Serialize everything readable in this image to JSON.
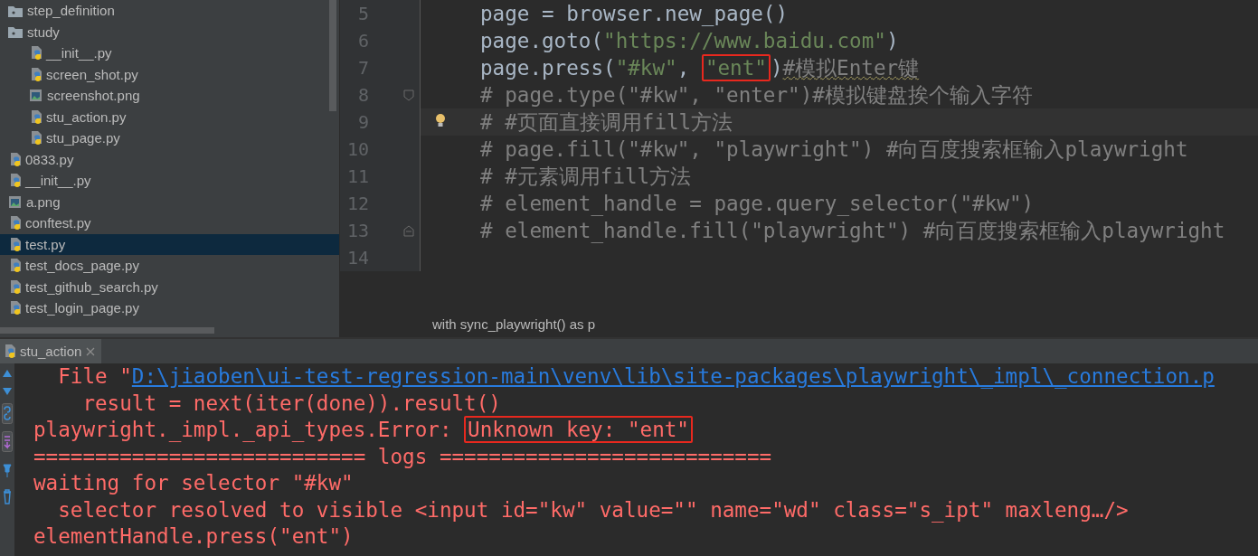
{
  "project_tree": {
    "items": [
      {
        "label": "step_definition",
        "kind": "folder",
        "selected": false
      },
      {
        "label": "study",
        "kind": "folder",
        "selected": false,
        "children": [
          {
            "label": "__init__.py",
            "kind": "python",
            "selected": false
          },
          {
            "label": "screen_shot.py",
            "kind": "python",
            "selected": false
          },
          {
            "label": "screenshot.png",
            "kind": "image",
            "selected": false
          },
          {
            "label": "stu_action.py",
            "kind": "python",
            "selected": false
          },
          {
            "label": "stu_page.py",
            "kind": "python",
            "selected": false
          }
        ]
      },
      {
        "label": "0833.py",
        "kind": "python",
        "selected": false
      },
      {
        "label": "__init__.py",
        "kind": "python",
        "selected": false
      },
      {
        "label": "a.png",
        "kind": "image",
        "selected": false
      },
      {
        "label": "conftest.py",
        "kind": "python",
        "selected": false
      },
      {
        "label": "test.py",
        "kind": "python",
        "selected": true
      },
      {
        "label": "test_docs_page.py",
        "kind": "python",
        "selected": false
      },
      {
        "label": "test_github_search.py",
        "kind": "python",
        "selected": false
      },
      {
        "label": "test_login_page.py",
        "kind": "python",
        "selected": false
      }
    ]
  },
  "editor": {
    "lines": [
      {
        "number": "5",
        "tokens": [
          {
            "text": "page = browser.new_page()",
            "kind": "code"
          }
        ]
      },
      {
        "number": "6",
        "tokens": [
          {
            "text": "page.goto(",
            "kind": "code"
          },
          {
            "text": "\"https://www.baidu.com\"",
            "kind": "string"
          },
          {
            "text": ")",
            "kind": "code"
          }
        ]
      },
      {
        "number": "7",
        "tokens": [
          {
            "text": "page.press(",
            "kind": "code"
          },
          {
            "text": "\"#kw\"",
            "kind": "string"
          },
          {
            "text": ", ",
            "kind": "code"
          },
          {
            "text": "\"ent\"",
            "kind": "string",
            "boxed": true
          },
          {
            "text": ")",
            "kind": "code"
          },
          {
            "text": "#模拟Enter键",
            "kind": "comment",
            "warned": true
          }
        ]
      },
      {
        "number": "8",
        "fold_start": true,
        "tokens": [
          {
            "text": "# page.type(\"#kw\", \"enter\")#模拟键盘挨个输入字符",
            "kind": "comment"
          }
        ]
      },
      {
        "number": "9",
        "current": true,
        "tokens": [
          {
            "text": "# #页面直接调用fill方法",
            "kind": "comment"
          }
        ]
      },
      {
        "number": "10",
        "tokens": [
          {
            "text": "# page.fill(\"#kw\", \"playwright\") #向百度搜索框输入playwright",
            "kind": "comment"
          }
        ]
      },
      {
        "number": "11",
        "tokens": [
          {
            "text": "# #元素调用fill方法",
            "kind": "comment"
          }
        ]
      },
      {
        "number": "12",
        "tokens": [
          {
            "text": "# element_handle = page.query_selector(\"#kw\")",
            "kind": "comment"
          }
        ]
      },
      {
        "number": "13",
        "fold_end": true,
        "tokens": [
          {
            "text": "# element_handle.fill(\"playwright\") #向百度搜索框输入playwright",
            "kind": "comment"
          }
        ]
      },
      {
        "number": "14"
      }
    ],
    "breadcrumb": "with sync_playwright() as p"
  },
  "run_panel": {
    "tab": {
      "label": "stu_action",
      "selected": true
    },
    "console": [
      {
        "segments": [
          {
            "text": "  File \"",
            "kind": "error"
          },
          {
            "text": "D:\\jiaoben\\ui-test-regression-main\\venv\\lib\\site-packages\\playwright\\_impl\\_connection.p",
            "kind": "link"
          }
        ]
      },
      {
        "segments": [
          {
            "text": "    result = next(iter(done)).result()",
            "kind": "error"
          }
        ]
      },
      {
        "segments": [
          {
            "text": "playwright._impl._api_types.Error: ",
            "kind": "error"
          },
          {
            "text": "Unknown key: \"ent\"",
            "kind": "error",
            "boxed": true
          }
        ]
      },
      {
        "segments": [
          {
            "text": "=========================== logs ===========================",
            "kind": "error"
          }
        ]
      },
      {
        "segments": [
          {
            "text": "waiting for selector \"#kw\"",
            "kind": "error"
          }
        ]
      },
      {
        "segments": [
          {
            "text": "  selector resolved to visible <input id=\"kw\" value=\"\" name=\"wd\" class=\"s_ipt\" maxleng…/>",
            "kind": "error"
          }
        ]
      },
      {
        "segments": [
          {
            "text": "elementHandle.press(\"ent\")",
            "kind": "error"
          }
        ]
      }
    ]
  }
}
